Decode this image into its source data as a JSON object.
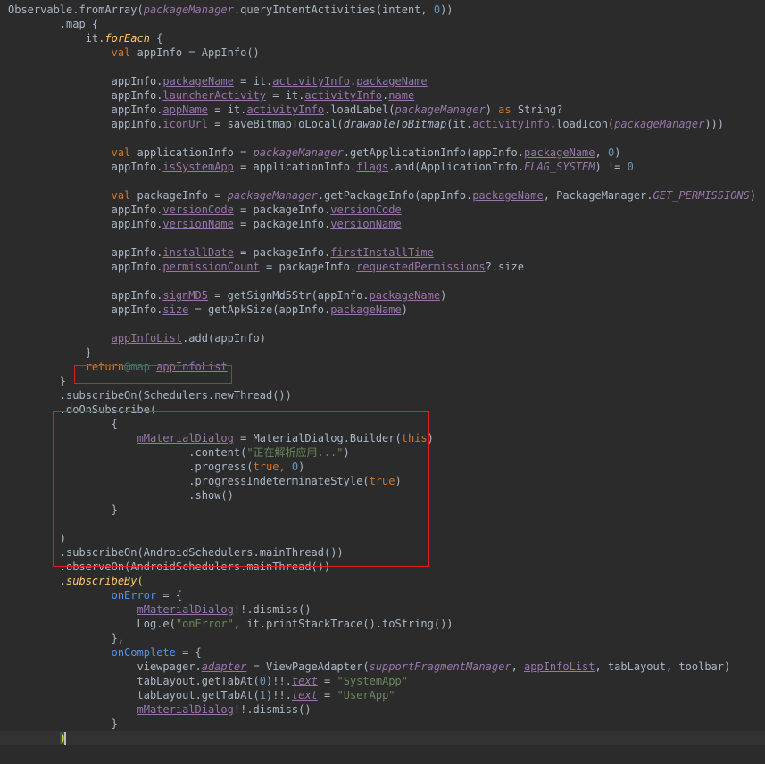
{
  "editor": {
    "lines": [
      [
        [
          "plain",
          "Observable.fromArray("
        ],
        [
          "ital",
          "packageManager"
        ],
        [
          "plain",
          ".queryIntentActivities(intent, "
        ],
        [
          "num",
          "0"
        ],
        [
          "plain",
          "))"
        ]
      ],
      [
        [
          "plain",
          "        .map {"
        ]
      ],
      [
        [
          "plain",
          "            it."
        ],
        [
          "kwital",
          "forEach"
        ],
        [
          "plain",
          " {"
        ]
      ],
      [
        [
          "plain",
          "                "
        ],
        [
          "kw",
          "val"
        ],
        [
          "plain",
          " appInfo = AppInfo()"
        ]
      ],
      [],
      [
        [
          "plain",
          "                appInfo."
        ],
        [
          "prop",
          "packageName"
        ],
        [
          "plain",
          " = "
        ],
        [
          "plain",
          "it"
        ],
        [
          "plain",
          "."
        ],
        [
          "prop",
          "activityInfo"
        ],
        [
          "plain",
          "."
        ],
        [
          "prop",
          "packageName"
        ]
      ],
      [
        [
          "plain",
          "                appInfo."
        ],
        [
          "prop",
          "launcherActivity"
        ],
        [
          "plain",
          " = "
        ],
        [
          "plain",
          "it"
        ],
        [
          "plain",
          "."
        ],
        [
          "prop",
          "activityInfo"
        ],
        [
          "plain",
          "."
        ],
        [
          "prop",
          "name"
        ]
      ],
      [
        [
          "plain",
          "                appInfo."
        ],
        [
          "prop",
          "appName"
        ],
        [
          "plain",
          " = "
        ],
        [
          "plain",
          "it"
        ],
        [
          "plain",
          "."
        ],
        [
          "prop",
          "activityInfo"
        ],
        [
          "plain",
          ".loadLabel("
        ],
        [
          "ital",
          "packageManager"
        ],
        [
          "plain",
          ") "
        ],
        [
          "kw",
          "as"
        ],
        [
          "plain",
          " String?"
        ]
      ],
      [
        [
          "plain",
          "                appInfo."
        ],
        [
          "prop",
          "iconUrl"
        ],
        [
          "plain",
          " = saveBitmapToLocal("
        ],
        [
          "fnital",
          "drawableToBitmap"
        ],
        [
          "plain",
          "("
        ],
        [
          "plain",
          "it"
        ],
        [
          "plain",
          "."
        ],
        [
          "prop",
          "activityInfo"
        ],
        [
          "plain",
          ".loadIcon("
        ],
        [
          "ital",
          "packageManager"
        ],
        [
          "plain",
          ")))"
        ]
      ],
      [],
      [
        [
          "plain",
          "                "
        ],
        [
          "kw",
          "val"
        ],
        [
          "plain",
          " applicationInfo = "
        ],
        [
          "ital",
          "packageManager"
        ],
        [
          "plain",
          ".getApplicationInfo(appInfo."
        ],
        [
          "prop",
          "packageName"
        ],
        [
          "plain",
          ", "
        ],
        [
          "num",
          "0"
        ],
        [
          "plain",
          ")"
        ]
      ],
      [
        [
          "plain",
          "                appInfo."
        ],
        [
          "prop",
          "isSystemApp"
        ],
        [
          "plain",
          " = applicationInfo."
        ],
        [
          "prop",
          "flags"
        ],
        [
          "plain",
          ".and(ApplicationInfo."
        ],
        [
          "ital",
          "FLAG_SYSTEM"
        ],
        [
          "plain",
          ") != "
        ],
        [
          "num",
          "0"
        ]
      ],
      [],
      [
        [
          "plain",
          "                "
        ],
        [
          "kw",
          "val"
        ],
        [
          "plain",
          " packageInfo = "
        ],
        [
          "ital",
          "packageManager"
        ],
        [
          "plain",
          ".getPackageInfo(appInfo."
        ],
        [
          "prop",
          "packageName"
        ],
        [
          "plain",
          ", PackageManager."
        ],
        [
          "ital",
          "GET_PERMISSIONS"
        ],
        [
          "plain",
          ")"
        ]
      ],
      [
        [
          "plain",
          "                appInfo."
        ],
        [
          "prop",
          "versionCode"
        ],
        [
          "plain",
          " = packageInfo."
        ],
        [
          "prop",
          "versionCode"
        ]
      ],
      [
        [
          "plain",
          "                appInfo."
        ],
        [
          "prop",
          "versionName"
        ],
        [
          "plain",
          " = packageInfo."
        ],
        [
          "prop",
          "versionName"
        ]
      ],
      [],
      [
        [
          "plain",
          "                appInfo."
        ],
        [
          "prop",
          "installDate"
        ],
        [
          "plain",
          " = packageInfo."
        ],
        [
          "prop",
          "firstInstallTime"
        ]
      ],
      [
        [
          "plain",
          "                appInfo."
        ],
        [
          "prop",
          "permissionCount"
        ],
        [
          "plain",
          " = packageInfo."
        ],
        [
          "prop",
          "requestedPermissions"
        ],
        [
          "plain",
          "?.size"
        ]
      ],
      [],
      [
        [
          "plain",
          "                appInfo."
        ],
        [
          "prop",
          "signMD5"
        ],
        [
          "plain",
          " = getSignMd5Str(appInfo."
        ],
        [
          "prop",
          "packageName"
        ],
        [
          "plain",
          ")"
        ]
      ],
      [
        [
          "plain",
          "                appInfo."
        ],
        [
          "prop",
          "size"
        ],
        [
          "plain",
          " = getApkSize(appInfo."
        ],
        [
          "prop",
          "packageName"
        ],
        [
          "plain",
          ")"
        ]
      ],
      [],
      [
        [
          "plain",
          "                "
        ],
        [
          "prop",
          "appInfoList"
        ],
        [
          "plain",
          ".add(appInfo)"
        ]
      ],
      [
        [
          "plain",
          "            }"
        ]
      ],
      [
        [
          "plain",
          "            "
        ],
        [
          "kw",
          "return"
        ],
        [
          "label",
          "@map"
        ],
        [
          "plain",
          " "
        ],
        [
          "prop",
          "appInfoList"
        ]
      ],
      [
        [
          "plain",
          "        }"
        ]
      ],
      [
        [
          "plain",
          "        .subscribeOn(Schedulers.newThread())"
        ]
      ],
      [
        [
          "plain",
          "        .doOnSubscribe("
        ]
      ],
      [
        [
          "plain",
          "                {"
        ]
      ],
      [
        [
          "plain",
          "                    "
        ],
        [
          "prop",
          "mMaterialDialog"
        ],
        [
          "plain",
          " = MaterialDialog.Builder("
        ],
        [
          "kw",
          "this"
        ],
        [
          "plain",
          ")"
        ]
      ],
      [
        [
          "plain",
          "                            .content("
        ],
        [
          "str",
          "\"正在解析应用...\""
        ],
        [
          "plain",
          ")"
        ]
      ],
      [
        [
          "plain",
          "                            .progress("
        ],
        [
          "kw",
          "true"
        ],
        [
          "kw",
          ", "
        ],
        [
          "num",
          "0"
        ],
        [
          "plain",
          ")"
        ]
      ],
      [
        [
          "plain",
          "                            .progressIndeterminateStyle("
        ],
        [
          "kw",
          "true"
        ],
        [
          "plain",
          ")"
        ]
      ],
      [
        [
          "plain",
          "                            .show()"
        ]
      ],
      [
        [
          "plain",
          "                }"
        ]
      ],
      [],
      [
        [
          "plain",
          "        )"
        ]
      ],
      [
        [
          "plain",
          "        .subscribeOn(AndroidSchedulers.mainThread())"
        ]
      ],
      [
        [
          "plain",
          "        .observeOn(AndroidSchedulers.mainThread())"
        ]
      ],
      [
        [
          "plain",
          "        ."
        ],
        [
          "kwital",
          "subscribeBy"
        ],
        [
          "brace",
          "("
        ]
      ],
      [
        [
          "plain",
          "                "
        ],
        [
          "param",
          "onError"
        ],
        [
          "plain",
          " = {"
        ]
      ],
      [
        [
          "plain",
          "                    "
        ],
        [
          "prop",
          "mMaterialDialog"
        ],
        [
          "plain",
          "!!.dismiss()"
        ]
      ],
      [
        [
          "plain",
          "                    Log.e("
        ],
        [
          "str",
          "\"onError\""
        ],
        [
          "plain",
          ", "
        ],
        [
          "plain",
          "it"
        ],
        [
          "plain",
          ".printStackTrace().toString())"
        ]
      ],
      [
        [
          "plain",
          "                },"
        ]
      ],
      [
        [
          "plain",
          "                "
        ],
        [
          "param",
          "onComplete"
        ],
        [
          "plain",
          " = {"
        ]
      ],
      [
        [
          "plain",
          "                    viewpager."
        ],
        [
          "italprop",
          "adapter"
        ],
        [
          "plain",
          " = ViewPageAdapter("
        ],
        [
          "ital",
          "supportFragmentManager"
        ],
        [
          "plain",
          ", "
        ],
        [
          "prop",
          "appInfoList"
        ],
        [
          "plain",
          ", tabLayout, toolbar)"
        ]
      ],
      [
        [
          "plain",
          "                    tabLayout.getTabAt("
        ],
        [
          "num",
          "0"
        ],
        [
          "plain",
          ")!!."
        ],
        [
          "italprop",
          "text"
        ],
        [
          "plain",
          " = "
        ],
        [
          "str",
          "\"SystemApp\""
        ]
      ],
      [
        [
          "plain",
          "                    tabLayout.getTabAt("
        ],
        [
          "num",
          "1"
        ],
        [
          "plain",
          ")!!."
        ],
        [
          "italprop",
          "text"
        ],
        [
          "plain",
          " = "
        ],
        [
          "str",
          "\"UserApp\""
        ]
      ],
      [
        [
          "plain",
          "                    "
        ],
        [
          "prop",
          "mMaterialDialog"
        ],
        [
          "plain",
          "!!.dismiss()"
        ]
      ],
      [
        [
          "plain",
          "                }"
        ]
      ],
      [
        [
          "plain",
          "        "
        ],
        [
          "bracehl",
          ")"
        ]
      ]
    ]
  },
  "theme": {
    "background": "#2b2b2b",
    "current_line": "#323232",
    "highlight_box": "#e02020"
  }
}
